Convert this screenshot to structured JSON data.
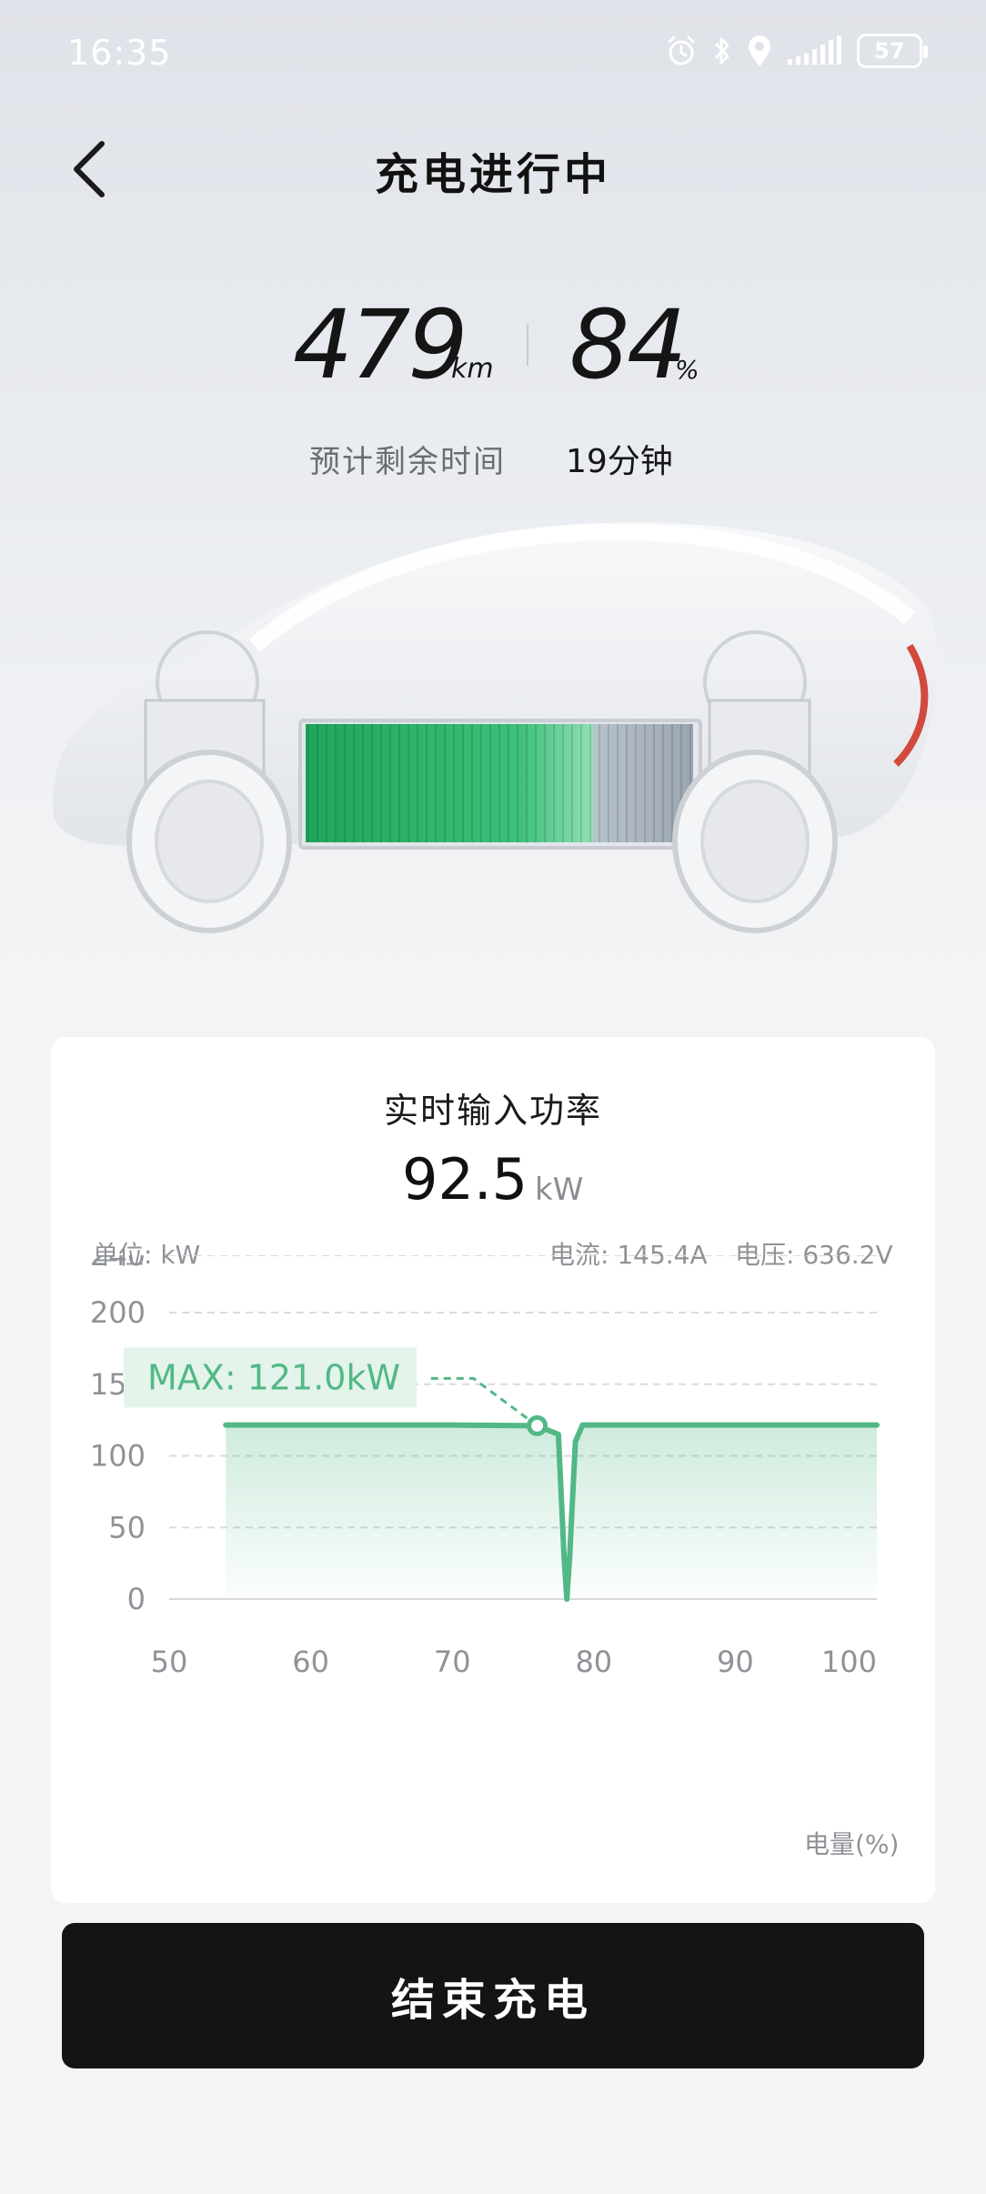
{
  "status_bar": {
    "time": "16:35",
    "battery": "57"
  },
  "header": {
    "title": "充电进行中"
  },
  "stats": {
    "range_value": "479",
    "range_unit": "km",
    "soc_value": "84",
    "soc_unit": "%",
    "eta_label": "预计剩余时间",
    "eta_value": "19分钟"
  },
  "power_card": {
    "title": "实时输入功率",
    "power_value": "92.5",
    "power_unit": "kW",
    "unit_label": "单位: kW",
    "current_label": "电流: 145.4A",
    "voltage_label": "电压: 636.2V",
    "x_axis_title": "电量(%)",
    "max_label": "MAX: 121.0kW"
  },
  "chart_data": {
    "type": "area",
    "title": "实时输入功率",
    "xlabel": "电量(%)",
    "ylabel": "",
    "x_ticks": [
      50,
      60,
      70,
      80,
      90,
      100
    ],
    "y_ticks": [
      0,
      50,
      100,
      150,
      200,
      240
    ],
    "xlim": [
      50,
      100
    ],
    "ylim": [
      0,
      240
    ],
    "grid": "horizontal dashed",
    "series_color": "#52b886",
    "x": [
      54,
      60,
      70,
      76,
      77.5,
      77.9,
      78.1,
      78.3,
      78.7,
      79.2,
      80,
      90,
      100
    ],
    "y": [
      121.5,
      121.5,
      121.5,
      121.0,
      115,
      30,
      0,
      30,
      110,
      121.5,
      121.5,
      121.5,
      121.5
    ],
    "annotation": {
      "text": "MAX: 121.0kW",
      "x": 76,
      "y": 121.0
    }
  },
  "actions": {
    "end_charging": "结束充电"
  },
  "colors": {
    "accent_green": "#52b886",
    "battery_green": "#2fb56a",
    "button_bg": "#141414"
  }
}
